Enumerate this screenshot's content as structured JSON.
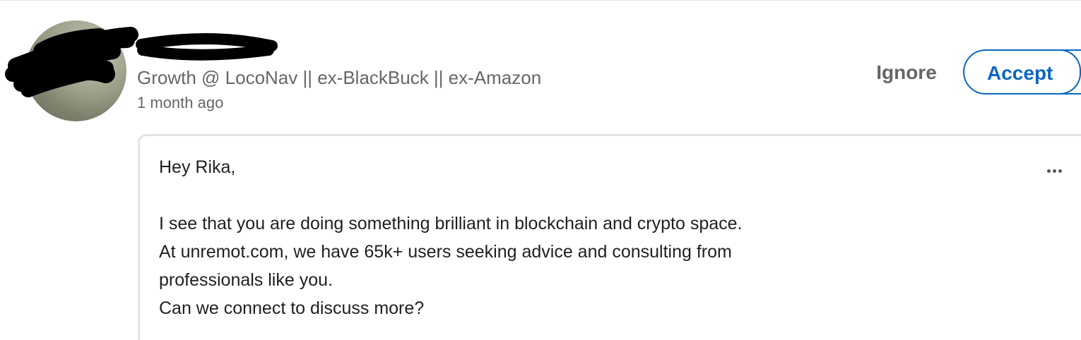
{
  "invitation": {
    "sender": {
      "name": "",
      "headline": "Growth @ LocoNav || ex-BlackBuck || ex-Amazon",
      "sent": "1 month ago"
    },
    "actions": {
      "ignore_label": "Ignore",
      "accept_label": "Accept"
    },
    "message": {
      "greeting": "Hey Rika,",
      "body": "I see that you are doing something brilliant in blockchain and crypto space.\nAt unremot.com, we have 65k+ users seeking advice and consulting from\nprofessionals like you.\nCan we connect to discuss more?",
      "more_icon": "more-horizontal-icon"
    }
  },
  "colors": {
    "accent": "#0a66c2",
    "secondary_text": "#666666",
    "primary_text": "#1f1f1f",
    "border": "#e3e3e3",
    "redaction": "#000000"
  }
}
